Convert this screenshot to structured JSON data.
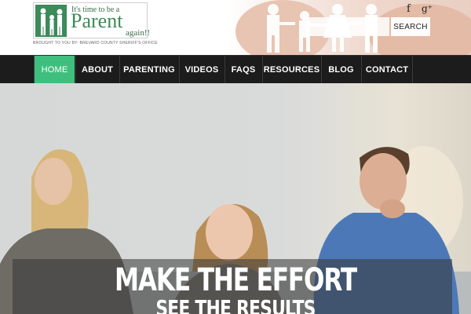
{
  "logo": {
    "small_text": "It's time to be a",
    "word": "Parent",
    "again": "again!!",
    "tagline": "BROUGHT TO YOU BY: BREVARD COUNTY SHERIFF'S OFFICE"
  },
  "social": {
    "facebook": "f",
    "googleplus": "g⁺"
  },
  "search": {
    "placeholder": "",
    "button_label": "SEARCH"
  },
  "nav": {
    "items": [
      {
        "label": "HOME",
        "active": true
      },
      {
        "label": "ABOUT"
      },
      {
        "label": "PARENTING"
      },
      {
        "label": "VIDEOS"
      },
      {
        "label": "FAQS"
      },
      {
        "label": "RESOURCES"
      },
      {
        "label": "BLOG"
      },
      {
        "label": "CONTACT"
      }
    ]
  },
  "hero": {
    "headline": "MAKE THE EFFORT",
    "subhead": "SEE THE RESULTS"
  },
  "colors": {
    "accent": "#3fbf7e",
    "nav_bg": "#1c1c1c",
    "logo_green": "#3d8a5a"
  }
}
